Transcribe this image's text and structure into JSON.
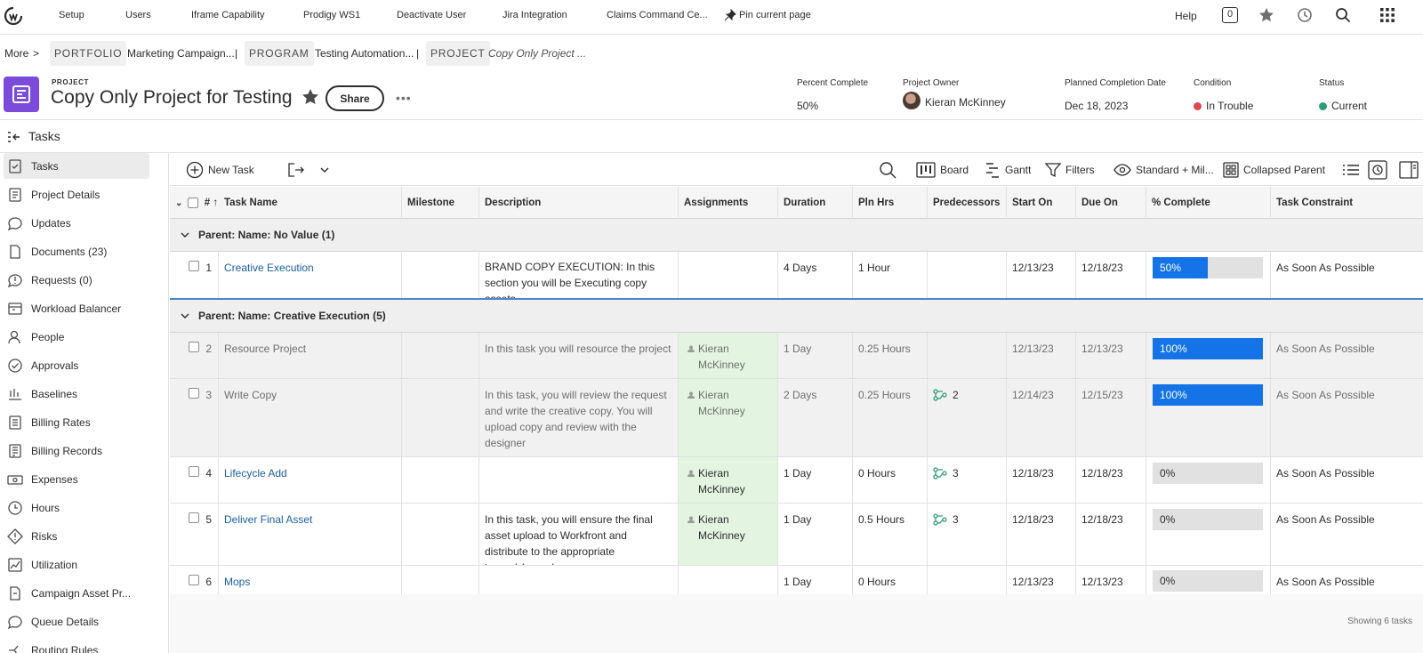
{
  "topnav": {
    "items": [
      "Setup",
      "Users",
      "Iframe Capability",
      "Prodigy WS1",
      "Deactivate User",
      "Jira Integration",
      "Claims Command Ce..."
    ],
    "pin_label": "Pin current page",
    "help_label": "Help",
    "notification_count": "0"
  },
  "breadcrumb": {
    "more": "More",
    "gt": ">",
    "portfolio_tag": "PORTFOLIO",
    "portfolio_name": "Marketing Campaign...",
    "sep1": "|",
    "program_tag": "PROGRAM",
    "program_name": "Testing Automation...",
    "sep2": "|",
    "project_tag": "PROJECT",
    "project_name": "Copy Only Project ..."
  },
  "header": {
    "kind": "PROJECT",
    "title": "Copy Only Project for Testing",
    "share_label": "Share",
    "more": "•••",
    "fields": [
      {
        "label": "Percent Complete",
        "value": "50%"
      },
      {
        "label": "Project Owner",
        "value": "Kieran McKinney"
      },
      {
        "label": "Planned Completion Date",
        "value": "Dec 18, 2023"
      },
      {
        "label": "Condition",
        "value": "In Trouble"
      },
      {
        "label": "Status",
        "value": "Current"
      }
    ],
    "colors": {
      "condition": "#e34850",
      "status": "#2d9d78",
      "accent": "#7b4bdb"
    }
  },
  "left_panel": {
    "title": "Tasks",
    "items": [
      "Tasks",
      "Project Details",
      "Updates",
      "Documents (23)",
      "Requests (0)",
      "Workload Balancer",
      "People",
      "Approvals",
      "Baselines",
      "Billing Rates",
      "Billing Records",
      "Expenses",
      "Hours",
      "Risks",
      "Utilization",
      "Campaign Asset Pr...",
      "Queue Details",
      "Routing Rules"
    ]
  },
  "toolbar": {
    "new_task": "New Task",
    "board": "Board",
    "gantt": "Gantt",
    "filters": "Filters",
    "view": "Standard + Mil...",
    "grouping": "Collapsed Parent"
  },
  "grid": {
    "columns": [
      "#",
      "Task Name",
      "Milestone",
      "Description",
      "Assignments",
      "Duration",
      "Pln Hrs",
      "Predecessors",
      "Start On",
      "Due On",
      "% Complete",
      "Task Constraint"
    ],
    "groups": [
      {
        "label": "Parent: Name: No Value (1)"
      },
      {
        "label": "Parent: Name: Creative Execution (5)"
      }
    ],
    "rows": [
      {
        "num": "1",
        "name": "Creative Execution",
        "milestone": "",
        "description": "BRAND COPY EXECUTION: In this section you will be Executing copy assets",
        "assignments": "",
        "duration": "4 Days",
        "pln_hrs": "1 Hour",
        "predecessors": "",
        "start": "12/13/23",
        "due": "12/18/23",
        "percent": "50%",
        "percent_value": 50,
        "constraint": "As Soon As Possible"
      },
      {
        "num": "2",
        "name": "Resource Project",
        "milestone": "",
        "description": "In this task you will resource the project",
        "assignments": "Kieran McKinney",
        "duration": "1 Day",
        "pln_hrs": "0.25 Hours",
        "predecessors": "",
        "start": "12/13/23",
        "due": "12/13/23",
        "percent": "100%",
        "percent_value": 100,
        "constraint": "As Soon As Possible"
      },
      {
        "num": "3",
        "name": "Write Copy",
        "milestone": "",
        "description": "In this task, you will review the request and write the creative copy. You will upload copy and review with the designer",
        "assignments": "Kieran McKinney",
        "duration": "2 Days",
        "pln_hrs": "0.25 Hours",
        "predecessors": "2",
        "start": "12/14/23",
        "due": "12/15/23",
        "percent": "100%",
        "percent_value": 100,
        "constraint": "As Soon As Possible"
      },
      {
        "num": "4",
        "name": "Lifecycle Add",
        "milestone": "",
        "description": "",
        "assignments": "Kieran McKinney",
        "duration": "1 Day",
        "pln_hrs": "0 Hours",
        "predecessors": "3",
        "start": "12/18/23",
        "due": "12/18/23",
        "percent": "0%",
        "percent_value": 0,
        "constraint": "As Soon As Possible"
      },
      {
        "num": "5",
        "name": "Deliver Final Asset",
        "milestone": "",
        "description": "In this task, you will ensure the final asset upload to Workfront and distribute to the appropriate teams/channels",
        "assignments": "Kieran McKinney",
        "duration": "1 Day",
        "pln_hrs": "0.5 Hours",
        "predecessors": "3",
        "start": "12/18/23",
        "due": "12/18/23",
        "percent": "0%",
        "percent_value": 0,
        "constraint": "As Soon As Possible"
      },
      {
        "num": "6",
        "name": "Mops",
        "milestone": "",
        "description": "",
        "assignments": "",
        "duration": "1 Day",
        "pln_hrs": "0 Hours",
        "predecessors": "",
        "start": "12/13/23",
        "due": "12/13/23",
        "percent": "0%",
        "percent_value": 0,
        "constraint": "As Soon As Possible"
      }
    ],
    "footer": "Showing 6 tasks"
  }
}
